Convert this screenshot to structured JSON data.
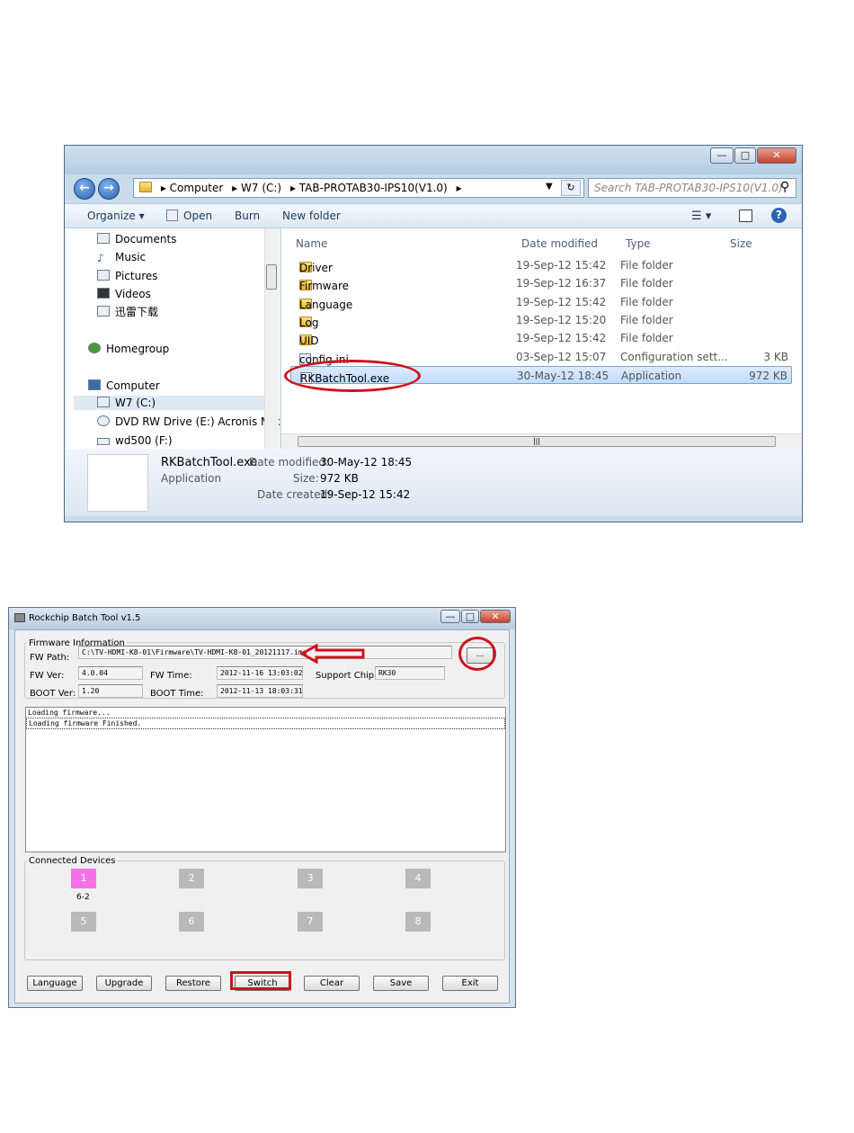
{
  "explorer": {
    "address": [
      "Computer",
      "W7 (C:)",
      "TAB-PROTAB30-IPS10(V1.0)"
    ],
    "search_placeholder": "Search TAB-PROTAB30-IPS10(V1.0)",
    "toolbar": {
      "organize": "Organize ▾",
      "open": "Open",
      "burn": "Burn",
      "new_folder": "New folder"
    },
    "nav": {
      "documents": "Documents",
      "music": "Music",
      "pictures": "Pictures",
      "videos": "Videos",
      "xunlei": "迅雷下载",
      "homegroup": "Homegroup",
      "computer": "Computer",
      "c_drive": "W7 (C:)",
      "dvd": "DVD RW Drive (E:) Acronis Media",
      "wd500": "wd500 (F:)"
    },
    "columns": {
      "name": "Name",
      "date": "Date modified",
      "type": "Type",
      "size": "Size"
    },
    "files": [
      {
        "name": "Driver",
        "date": "19-Sep-12 15:42",
        "type": "File folder",
        "size": ""
      },
      {
        "name": "Firmware",
        "date": "19-Sep-12 16:37",
        "type": "File folder",
        "size": ""
      },
      {
        "name": "Language",
        "date": "19-Sep-12 15:42",
        "type": "File folder",
        "size": ""
      },
      {
        "name": "Log",
        "date": "19-Sep-12 15:20",
        "type": "File folder",
        "size": ""
      },
      {
        "name": "UID",
        "date": "19-Sep-12 15:42",
        "type": "File folder",
        "size": ""
      },
      {
        "name": "config.ini",
        "date": "03-Sep-12 15:07",
        "type": "Configuration sett...",
        "size": "3 KB"
      },
      {
        "name": "RKBatchTool.exe",
        "date": "30-May-12 18:45",
        "type": "Application",
        "size": "972 KB"
      }
    ],
    "details": {
      "filename": "RKBatchTool.exe",
      "filetype": "Application",
      "modified_label": "Date modified:",
      "modified": "30-May-12 18:45",
      "size_label": "Size:",
      "size": "972 KB",
      "created_label": "Date created:",
      "created": "19-Sep-12 15:42"
    }
  },
  "rk": {
    "title": "Rockchip Batch Tool v1.5",
    "fw_group": "Firmware Information",
    "fw_path_label": "FW Path:",
    "fw_path": "C:\\TV-HDMI-K8-01\\Firmware\\TV-HDMI-K8-01_20121117.img",
    "browse": "...",
    "fw_ver_label": "FW Ver:",
    "fw_ver": "4.0.04",
    "fw_time_label": "FW Time:",
    "fw_time": "2012-11-16 13:03:02",
    "chip_label": "Support Chip:",
    "chip": "RK30",
    "boot_ver_label": "BOOT Ver:",
    "boot_ver": "1.20",
    "boot_time_label": "BOOT Time:",
    "boot_time": "2012-11-13 18:03:31",
    "log": [
      "Loading firmware...",
      "Loading firmware Finished."
    ],
    "devices_group": "Connected Devices",
    "devices": [
      "1",
      "2",
      "3",
      "4",
      "5",
      "6",
      "7",
      "8"
    ],
    "device1_port": "6-2",
    "buttons": {
      "language": "Language",
      "upgrade": "Upgrade",
      "restore": "Restore",
      "switch": "Switch",
      "clear": "Clear",
      "save": "Save",
      "exit": "Exit"
    },
    "accent": "#f472e6"
  },
  "annotation_color": "#d0111b"
}
